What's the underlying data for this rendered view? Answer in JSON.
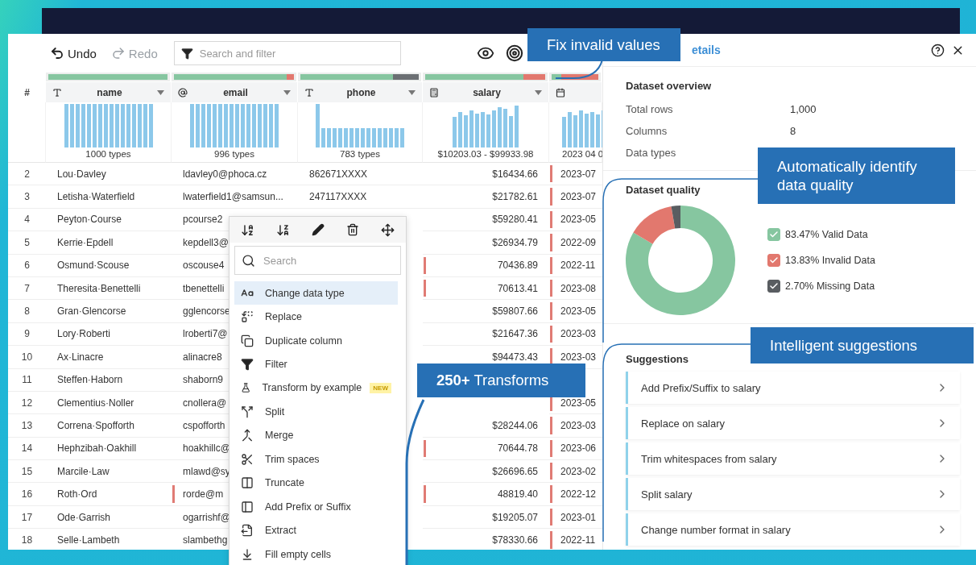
{
  "toolbar": {
    "undo": {
      "label": "Undo",
      "disabled": false
    },
    "redo": {
      "label": "Redo",
      "disabled": true
    },
    "search": {
      "placeholder": "Search and filter"
    }
  },
  "table": {
    "index_header": "#",
    "columns": [
      {
        "name": "name",
        "kind": "text",
        "summary": "1000 types",
        "quality": [
          {
            "kind": "valid",
            "level": 1
          }
        ]
      },
      {
        "name": "email",
        "kind": "email",
        "summary": "996 types",
        "quality": [
          {
            "kind": "valid",
            "level": 0.94
          },
          {
            "kind": "invalid",
            "level": 0.06
          }
        ]
      },
      {
        "name": "phone",
        "kind": "text",
        "summary": "783 types",
        "quality": [
          {
            "kind": "valid",
            "level": 0.78
          },
          {
            "kind": "missing",
            "level": 0.22
          }
        ]
      },
      {
        "name": "salary",
        "kind": "number",
        "summary": "$10203.03 - $99933.98",
        "quality": [
          {
            "kind": "valid",
            "level": 0.82
          },
          {
            "kind": "invalid",
            "level": 0.18
          }
        ]
      },
      {
        "kind": "date",
        "summary": "2023 04 0",
        "quality": [
          {
            "kind": "valid",
            "level": 0.2
          },
          {
            "kind": "invalid",
            "level": 0.8
          }
        ]
      }
    ],
    "rows": [
      {
        "index": "2",
        "cells": [
          {
            "text": "Lou·Davley",
            "invalid": false
          },
          {
            "text": "ldavley0@phoca.cz",
            "invalid": false
          },
          {
            "text": "862671XXXX",
            "invalid": false
          },
          {
            "text": "$16434.66",
            "invalid": false
          },
          {
            "text": "2023-07",
            "invalid": true
          }
        ]
      },
      {
        "index": "3",
        "cells": [
          {
            "text": "Letisha·Waterfield",
            "invalid": false
          },
          {
            "text": "lwaterfield1@samsun...",
            "invalid": false
          },
          {
            "text": "247117XXXX",
            "invalid": false
          },
          {
            "text": "$21782.61",
            "invalid": false
          },
          {
            "text": "2023-07",
            "invalid": true
          }
        ]
      },
      {
        "index": "4",
        "cells": [
          {
            "text": "Peyton·Course",
            "invalid": false
          },
          {
            "text": "pcourse2",
            "invalid": false
          },
          null,
          {
            "text": "$59280.41",
            "invalid": false
          },
          {
            "text": "2023-05",
            "invalid": true
          }
        ]
      },
      {
        "index": "5",
        "cells": [
          {
            "text": "Kerrie·Epdell",
            "invalid": false
          },
          {
            "text": "kepdell3@",
            "invalid": false
          },
          null,
          {
            "text": "$26934.79",
            "invalid": false
          },
          {
            "text": "2022-09",
            "invalid": true
          }
        ]
      },
      {
        "index": "6",
        "cells": [
          {
            "text": "Osmund·Scouse",
            "invalid": false
          },
          {
            "text": "oscouse4",
            "invalid": false
          },
          null,
          {
            "text": "70436.89",
            "invalid": true
          },
          {
            "text": "2022-11",
            "invalid": true
          }
        ]
      },
      {
        "index": "7",
        "cells": [
          {
            "text": "Theresita·Benettelli",
            "invalid": false
          },
          {
            "text": "tbenettelli",
            "invalid": false
          },
          null,
          {
            "text": "70613.41",
            "invalid": true
          },
          {
            "text": "2023-08",
            "invalid": true
          }
        ]
      },
      {
        "index": "8",
        "cells": [
          {
            "text": "Gran·Glencorse",
            "invalid": false
          },
          {
            "text": "gglencorse",
            "invalid": false
          },
          null,
          {
            "text": "$59807.66",
            "invalid": false
          },
          {
            "text": "2023-05",
            "invalid": true
          }
        ]
      },
      {
        "index": "9",
        "cells": [
          {
            "text": "Lory·Roberti",
            "invalid": false
          },
          {
            "text": "lroberti7@",
            "invalid": false
          },
          null,
          {
            "text": "$21647.36",
            "invalid": false
          },
          {
            "text": "2023-03",
            "invalid": true
          }
        ]
      },
      {
        "index": "10",
        "cells": [
          {
            "text": "Ax·Linacre",
            "invalid": false
          },
          {
            "text": "alinacre8",
            "invalid": false
          },
          null,
          {
            "text": "$94473.43",
            "invalid": false
          },
          {
            "text": "2023-03",
            "invalid": true
          }
        ]
      },
      {
        "index": "11",
        "cells": [
          {
            "text": "Steffen·Haborn",
            "invalid": false
          },
          {
            "text": "shaborn9",
            "invalid": false
          },
          null,
          null,
          null
        ]
      },
      {
        "index": "12",
        "cells": [
          {
            "text": "Clementius·Noller",
            "invalid": false
          },
          {
            "text": "cnollera@",
            "invalid": false
          },
          null,
          null,
          {
            "text": "2023-05",
            "invalid": true
          }
        ]
      },
      {
        "index": "13",
        "cells": [
          {
            "text": "Correna·Spofforth",
            "invalid": false
          },
          {
            "text": "cspofforth",
            "invalid": false
          },
          null,
          {
            "text": "$28244.06",
            "invalid": false
          },
          {
            "text": "2023-03",
            "invalid": true
          }
        ]
      },
      {
        "index": "14",
        "cells": [
          {
            "text": "Hephzibah·Oakhill",
            "invalid": false
          },
          {
            "text": "hoakhillc@",
            "invalid": false
          },
          null,
          {
            "text": "70644.78",
            "invalid": true
          },
          {
            "text": "2023-06",
            "invalid": true
          }
        ]
      },
      {
        "index": "15",
        "cells": [
          {
            "text": "Marcile·Law",
            "invalid": false
          },
          {
            "text": "mlawd@sy",
            "invalid": false
          },
          null,
          {
            "text": "$26696.65",
            "invalid": false
          },
          {
            "text": "2023-02",
            "invalid": true
          }
        ]
      },
      {
        "index": "16",
        "cells": [
          {
            "text": "Roth·Ord",
            "invalid": false
          },
          {
            "text": "rorde@m",
            "invalid": true
          },
          null,
          {
            "text": "48819.40",
            "invalid": true
          },
          {
            "text": "2022-12",
            "invalid": true
          }
        ]
      },
      {
        "index": "17",
        "cells": [
          {
            "text": "Ode·Garrish",
            "invalid": false
          },
          {
            "text": "ogarrishf@",
            "invalid": false
          },
          null,
          {
            "text": "$19205.07",
            "invalid": false
          },
          {
            "text": "2023-01",
            "invalid": true
          }
        ]
      },
      {
        "index": "18",
        "cells": [
          {
            "text": "Selle·Lambeth",
            "invalid": false
          },
          {
            "text": "slambethg",
            "invalid": false
          },
          null,
          {
            "text": "$78330.66",
            "invalid": false
          },
          {
            "text": "2022-11",
            "invalid": true
          }
        ]
      }
    ]
  },
  "column_menu": {
    "search": {
      "placeholder": "Search"
    },
    "items": [
      {
        "label": "Change data type",
        "kind": "type",
        "selected": true
      },
      {
        "label": "Replace",
        "kind": "replace",
        "selected": false
      },
      {
        "label": "Duplicate column",
        "kind": "copy",
        "selected": false
      },
      {
        "label": "Filter",
        "kind": "filter",
        "selected": false
      },
      {
        "label": "Transform by example",
        "kind": "flask",
        "selected": false,
        "badge": "NEW"
      },
      {
        "label": "Split",
        "kind": "split",
        "selected": false
      },
      {
        "label": "Merge",
        "kind": "merge",
        "selected": false
      },
      {
        "label": "Trim spaces",
        "kind": "scissors",
        "selected": false
      },
      {
        "label": "Truncate",
        "kind": "columns",
        "selected": false
      },
      {
        "label": "Add Prefix or Suffix",
        "kind": "panel",
        "selected": false
      },
      {
        "label": "Extract",
        "kind": "extract",
        "selected": false
      },
      {
        "label": "Fill empty cells",
        "kind": "fill",
        "selected": false
      }
    ]
  },
  "details_panel": {
    "title": "etails",
    "overview": {
      "title": "Dataset overview",
      "rows": [
        {
          "label": "Total rows",
          "value": "1,000"
        },
        {
          "label": "Columns",
          "value": "8"
        },
        {
          "label": "Data types"
        }
      ]
    },
    "quality": {
      "title": "Dataset quality",
      "chart_data": {
        "type": "donut",
        "values": [
          83.47,
          13.83,
          2.7
        ]
      },
      "legend": [
        {
          "label": "83.47% Valid Data",
          "color": "#86c6a0",
          "checked": true
        },
        {
          "label": "13.83% Invalid Data",
          "color": "#e2786e",
          "checked": true
        },
        {
          "label": "2.70% Missing Data",
          "color": "#595d61",
          "checked": true
        }
      ]
    },
    "suggestions": {
      "title": "Suggestions",
      "items": [
        "Add Prefix/Suffix to salary",
        "Replace on salary",
        "Trim whitespaces from salary",
        "Split salary",
        "Change number format in salary"
      ]
    }
  },
  "callouts": [
    {
      "text": "Fix invalid values"
    },
    {
      "text": "Automatically identify data quality"
    },
    {
      "text": "Intelligent suggestions"
    },
    {
      "text": "**250+** Transforms"
    }
  ]
}
